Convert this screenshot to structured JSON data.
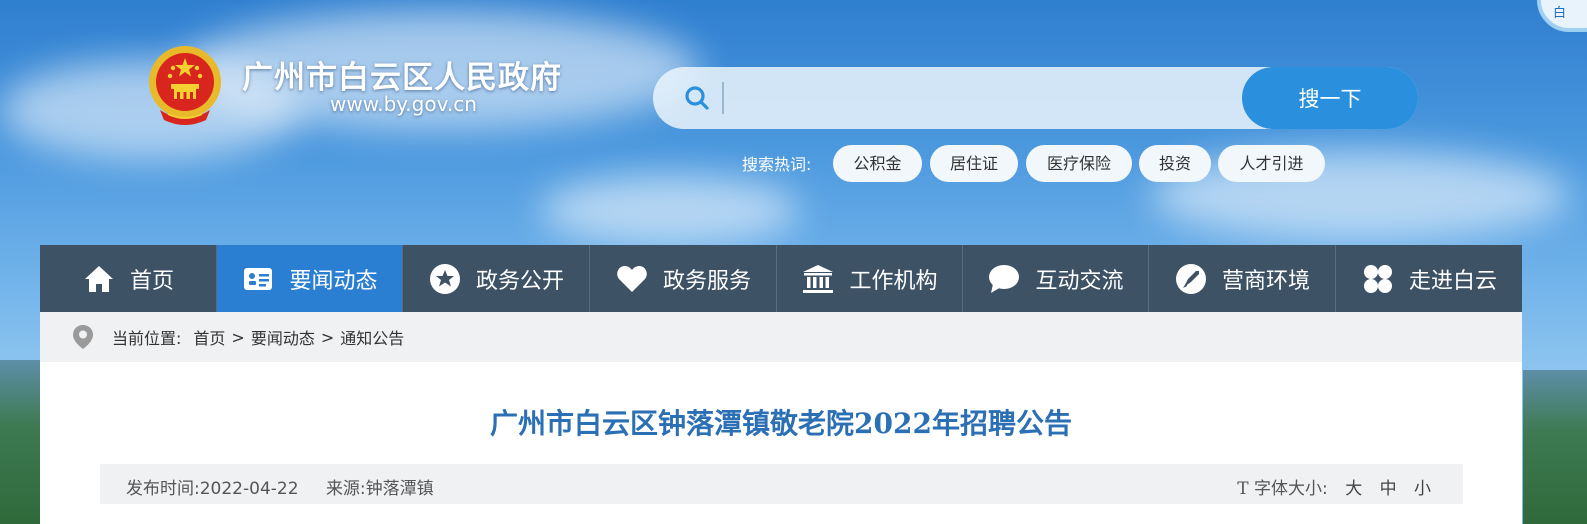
{
  "site": {
    "title": "广州市白云区人民政府",
    "url": "www.by.gov.cn",
    "corner_badge_text": "白"
  },
  "search": {
    "placeholder": "",
    "value": "",
    "button_label": "搜一下",
    "hot_label": "搜索热词:",
    "hot_tags": [
      "公积金",
      "居住证",
      "医疗保险",
      "投资",
      "人才引进"
    ]
  },
  "nav": {
    "items": [
      {
        "label": "首页",
        "icon": "home-icon"
      },
      {
        "label": "要闻动态",
        "icon": "news-card-icon",
        "active": true
      },
      {
        "label": "政务公开",
        "icon": "star-badge-icon"
      },
      {
        "label": "政务服务",
        "icon": "heart-icon"
      },
      {
        "label": "工作机构",
        "icon": "building-icon"
      },
      {
        "label": "互动交流",
        "icon": "chat-bubble-icon"
      },
      {
        "label": "营商环境",
        "icon": "rocket-icon"
      },
      {
        "label": "走进白云",
        "icon": "grid-flower-icon"
      }
    ]
  },
  "breadcrumb": {
    "label": "当前位置:",
    "items": [
      "首页",
      "要闻动态",
      "通知公告"
    ],
    "separator": ">"
  },
  "article": {
    "title": "广州市白云区钟落潭镇敬老院2022年招聘公告",
    "publish_label": "发布时间:",
    "publish_date": "2022-04-22",
    "source_label": "来源:",
    "source": "钟落潭镇",
    "font_size_label": "字体大小:",
    "font_sizes": [
      "大",
      "中",
      "小"
    ]
  },
  "colors": {
    "nav_bg": "#3e5266",
    "nav_active": "#2b7fd2",
    "title_blue": "#2b6fb5",
    "search_button": "#2a8fdc"
  }
}
